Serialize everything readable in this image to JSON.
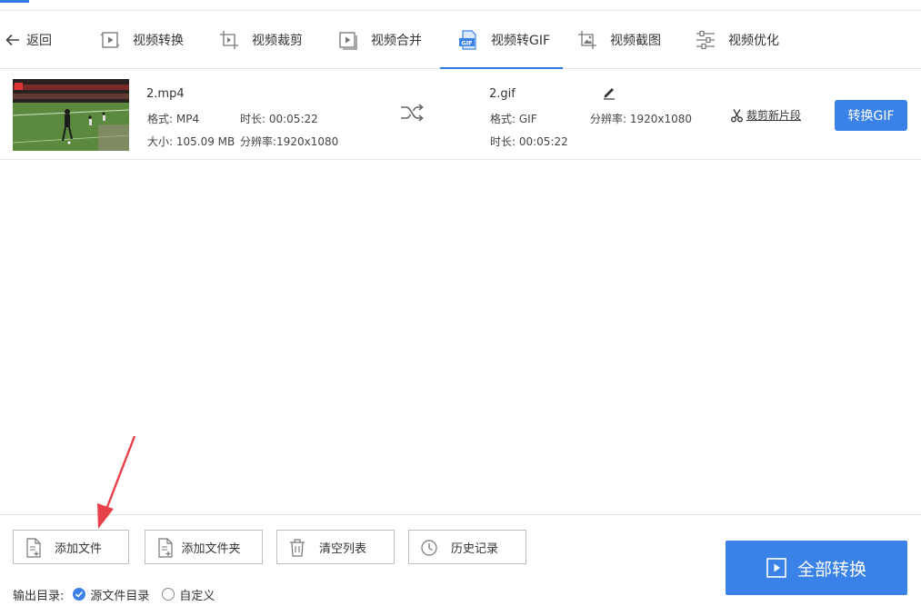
{
  "nav": {
    "back_label": "返回",
    "tabs": [
      {
        "label": "视频转换",
        "icon": "video-convert-icon"
      },
      {
        "label": "视频裁剪",
        "icon": "video-crop-icon"
      },
      {
        "label": "视频合并",
        "icon": "video-merge-icon"
      },
      {
        "label": "视频转GIF",
        "icon": "gif-icon",
        "active": true
      },
      {
        "label": "视频截图",
        "icon": "screenshot-icon"
      },
      {
        "label": "视频优化",
        "icon": "sliders-icon"
      }
    ]
  },
  "file": {
    "source": {
      "name": "2.mp4",
      "format": "格式: MP4",
      "duration": "时长: 00:05:22",
      "size": "大小: 105.09 MB",
      "resolution": "分辨率:1920x1080"
    },
    "output": {
      "name": "2.gif",
      "format": "格式: GIF",
      "resolution": "分辨率: 1920x1080",
      "duration": "时长: 00:05:22"
    },
    "cut_label": "裁剪新片段",
    "convert_label": "转换GIF"
  },
  "toolbar": {
    "add_file": "添加文件",
    "add_folder": "添加文件夹",
    "clear_list": "清空列表",
    "history": "历史记录"
  },
  "output_dir": {
    "label": "输出目录:",
    "options": [
      {
        "label": "源文件目录",
        "checked": true
      },
      {
        "label": "自定义",
        "checked": false
      }
    ]
  },
  "convert_all_label": "全部转换",
  "colors": {
    "accent": "#3a82e8",
    "annotation_arrow": "#e8414a"
  }
}
